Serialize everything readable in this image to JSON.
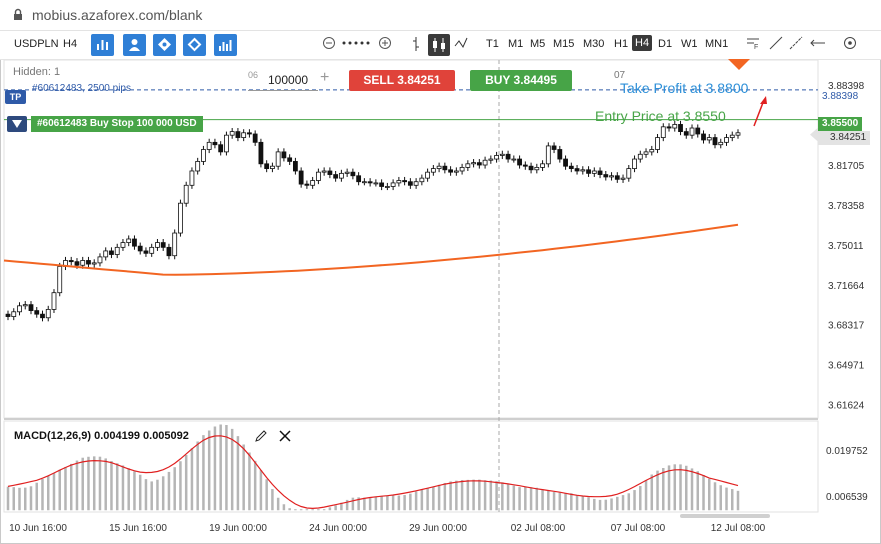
{
  "browser": {
    "url": "mobius.azaforex.com/blank"
  },
  "toolbar": {
    "symbol": "USDPLN",
    "period": "H4",
    "timeframes": [
      "T1",
      "M1",
      "M5",
      "M15",
      "M30",
      "H1",
      "H4",
      "D1",
      "W1",
      "MN1"
    ],
    "active_timeframe": "H4",
    "tool_icons": [
      "bar-chart-icon",
      "person-icon",
      "tag-icon",
      "diamond-icon",
      "indicators-icon"
    ]
  },
  "trade": {
    "hidden_label": "Hidden: 1",
    "qty_label": "06",
    "quantity": "100000",
    "plus": "+",
    "sell_label": "SELL",
    "sell_price": "3.84251",
    "buy_label": "BUY",
    "buy_price": "3.84495",
    "marker_07": "07"
  },
  "annotations": {
    "take_profit": "Take Profit at 3.8800",
    "entry": "Entry Price at 3.8550",
    "tp_badge": "TP",
    "tp_info": "#60612483, 2500 pips",
    "entry_label": "#60612483 Buy Stop 100 000 USD",
    "tp_price_tag": "3.88398",
    "entry_price_tag": "3.85500",
    "current_price_tag": "3.84251"
  },
  "colors": {
    "accent": "#2f7fd6",
    "sell": "#e0433a",
    "buy": "#47a447",
    "take_profit": "#2d8fd8",
    "ma_line": "#f26522",
    "macd_signal": "#e02020",
    "histogram": "#b5b5b5"
  },
  "chart_data": [
    {
      "type": "candlestick",
      "symbol": "USDPLN",
      "timeframe": "H4",
      "y_ticks": [
        3.88398,
        3.84251,
        3.81705,
        3.78358,
        3.75011,
        3.71664,
        3.68317,
        3.64971,
        3.61624
      ],
      "x_ticks": [
        "10 Jun 16:00",
        "15 Jun 16:00",
        "19 Jun 00:00",
        "24 Jun 00:00",
        "29 Jun 00:00",
        "02 Jul 08:00",
        "07 Jul 08:00",
        "12 Jul 08:00"
      ],
      "ylim": [
        3.605,
        3.905
      ],
      "closes": [
        3.69,
        3.694,
        3.699,
        3.7,
        3.695,
        3.692,
        3.689,
        3.696,
        3.71,
        3.732,
        3.737,
        3.736,
        3.733,
        3.737,
        3.734,
        3.735,
        3.74,
        3.745,
        3.742,
        3.748,
        3.752,
        3.755,
        3.749,
        3.745,
        3.743,
        3.748,
        3.752,
        3.748,
        3.741,
        3.76,
        3.785,
        3.8,
        3.812,
        3.82,
        3.83,
        3.836,
        3.834,
        3.828,
        3.842,
        3.845,
        3.84,
        3.844,
        3.843,
        3.836,
        3.818,
        3.814,
        3.816,
        3.828,
        3.823,
        3.82,
        3.812,
        3.801,
        3.8,
        3.804,
        3.811,
        3.812,
        3.809,
        3.806,
        3.81,
        3.811,
        3.808,
        3.803,
        3.803,
        3.802,
        3.802,
        3.799,
        3.799,
        3.802,
        3.804,
        3.803,
        3.8,
        3.803,
        3.806,
        3.811,
        3.814,
        3.816,
        3.813,
        3.811,
        3.812,
        3.815,
        3.818,
        3.819,
        3.817,
        3.821,
        3.822,
        3.825,
        3.826,
        3.822,
        3.822,
        3.817,
        3.816,
        3.813,
        3.815,
        3.818,
        3.833,
        3.83,
        3.822,
        3.816,
        3.814,
        3.812,
        3.813,
        3.81,
        3.812,
        3.809,
        3.807,
        3.808,
        3.805,
        3.806,
        3.814,
        3.822,
        3.826,
        3.828,
        3.83,
        3.84,
        3.849,
        3.848,
        3.851,
        3.845,
        3.842,
        3.848,
        3.843,
        3.838,
        3.84,
        3.834,
        3.836,
        3.84,
        3.842,
        3.844
      ],
      "moving_average": {
        "start": 3.737,
        "min": 3.725,
        "end": 3.767
      },
      "current_price": 3.84251,
      "entry_price": 3.855,
      "take_profit": 3.88
    },
    {
      "type": "bar",
      "title": "MACD(12,26,9) 0.004199 0.005092",
      "y_ticks": [
        0.019752,
        0.006539
      ],
      "ylim": [
        0.002,
        0.028
      ]
    }
  ]
}
